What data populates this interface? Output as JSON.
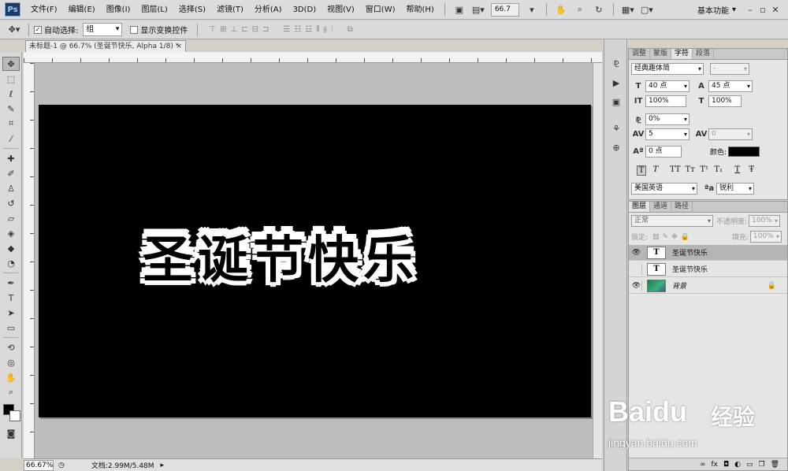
{
  "app": {
    "logo": "Ps"
  },
  "menu": [
    "文件(F)",
    "编辑(E)",
    "图像(I)",
    "图层(L)",
    "选择(S)",
    "滤镜(T)",
    "分析(A)",
    "3D(D)",
    "视图(V)",
    "窗口(W)",
    "帮助(H)"
  ],
  "menubar": {
    "zoom": "66.7",
    "workspace": "基本功能"
  },
  "options": {
    "auto_select_label": "自动选择:",
    "auto_select_value": "组",
    "show_transform_label": "显示变换控件"
  },
  "document": {
    "tab_title": "未标题-1 @ 66.7% (圣诞节快乐, Alpha 1/8) *",
    "close_glyph": "×",
    "canvas_text": "圣诞节快乐",
    "status_zoom": "66.67%",
    "status_doc": "文档:2.99M/5.48M"
  },
  "char_panel": {
    "tabs": [
      "调整",
      "蒙版",
      "字符",
      "段落"
    ],
    "active_tab": "字符",
    "font_family": "经典趣体简",
    "font_style": "-",
    "font_size": "40 点",
    "leading": "45 点",
    "vertical_scale": "100%",
    "horizontal_scale": "100%",
    "tracking_percent": "0%",
    "tracking": "5",
    "kerning": "0",
    "baseline_shift": "0 点",
    "color_label": "颜色:",
    "color": "#000000",
    "style_buttons": [
      "T",
      "T",
      "TT",
      "Tт",
      "T¹",
      "T₁",
      "T",
      "Ŧ"
    ],
    "language": "美国英语",
    "aa_label": "ªa",
    "antialias": "锐利"
  },
  "layers_panel": {
    "tabs": [
      "图层",
      "通道",
      "路径"
    ],
    "blend_mode": "正常",
    "opacity_label": "不透明度:",
    "opacity": "100%",
    "lock_label": "锁定:",
    "fill_label": "填充:",
    "fill": "100%",
    "layers": [
      {
        "name": "圣诞节快乐",
        "type": "text",
        "visible": true,
        "selected": true
      },
      {
        "name": "圣诞节快乐",
        "type": "text",
        "visible": false,
        "selected": false
      },
      {
        "name": "背景",
        "type": "background",
        "visible": true,
        "selected": false
      }
    ]
  },
  "watermark": {
    "brand": "Baidu",
    "cn": "经验",
    "url": "jingyan.baidu.com"
  }
}
